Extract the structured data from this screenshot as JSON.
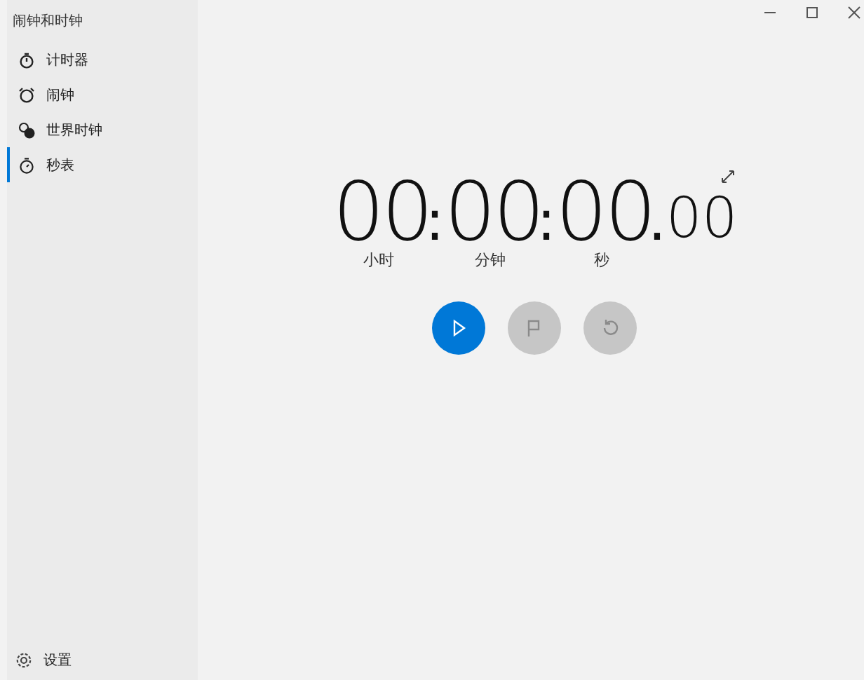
{
  "window": {
    "title": "闹钟和时钟"
  },
  "sidebar": {
    "items": [
      {
        "label": "计时器",
        "kind": "timer",
        "selected": false
      },
      {
        "label": "闹钟",
        "kind": "alarm",
        "selected": false
      },
      {
        "label": "世界时钟",
        "kind": "world",
        "selected": false
      },
      {
        "label": "秒表",
        "kind": "stopwatch",
        "selected": true
      }
    ],
    "footer": {
      "label": "设置",
      "kind": "settings"
    }
  },
  "stopwatch": {
    "units": [
      {
        "digits": "00",
        "label": "小时",
        "separator": ":"
      },
      {
        "digits": "00",
        "label": "分钟",
        "separator": ":"
      },
      {
        "digits": "00",
        "label": "秒",
        "separator": "."
      }
    ],
    "fraction": "00",
    "buttons": [
      {
        "kind": "start",
        "disabled": false
      },
      {
        "kind": "lap",
        "disabled": true
      },
      {
        "kind": "reset",
        "disabled": true
      }
    ]
  }
}
